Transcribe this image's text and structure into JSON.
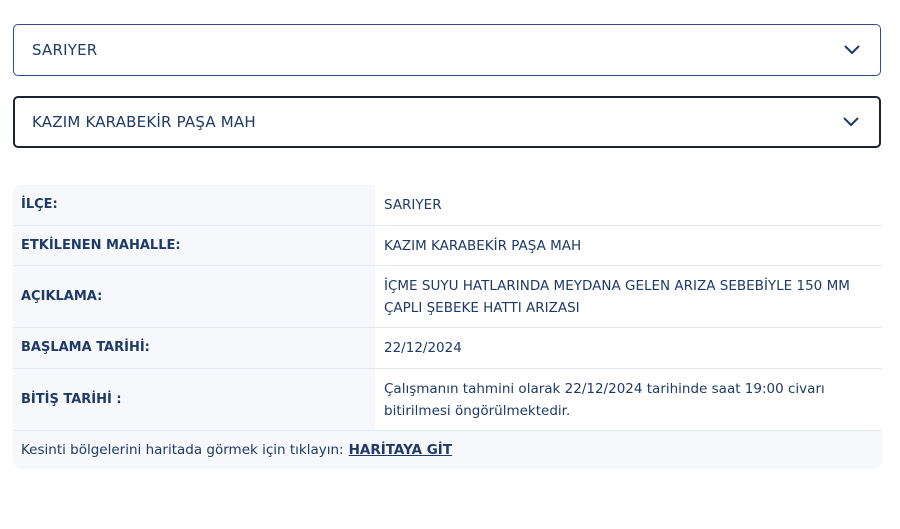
{
  "district_select": {
    "value": "SARIYER",
    "icon": "chevron-down-icon"
  },
  "neighborhood_select": {
    "value": "KAZIM KARABEKİR PAŞA MAH",
    "icon": "chevron-down-icon"
  },
  "outage_info": {
    "rows": [
      {
        "label": "İLÇE:",
        "value": "SARIYER"
      },
      {
        "label": "ETKİLENEN MAHALLE:",
        "value": "KAZIM KARABEKİR PAŞA MAH"
      },
      {
        "label": "AÇIKLAMA:",
        "value": "İÇME SUYU HATLARINDA MEYDANA GELEN ARIZA SEBEBİYLE 150 MM ÇAPLI ŞEBEKE HATTI ARIZASI"
      },
      {
        "label": "BAŞLAMA TARİHİ:",
        "value": "22/12/2024"
      },
      {
        "label": "BİTİŞ TARİHİ :",
        "value": "Çalışmanın tahmini olarak 22/12/2024 tarihinde saat 19:00 civarı bitirilmesi öngörülmektedir."
      }
    ],
    "map_prompt": "Kesinti bölgelerini haritada görmek için tıklayın:",
    "map_link": "HARİTAYA GİT"
  },
  "colors": {
    "text": "#1f3a66",
    "select_border": "#2e4f83",
    "select_focus_border": "#1b2434",
    "card_bg": "#f6f8fb"
  }
}
